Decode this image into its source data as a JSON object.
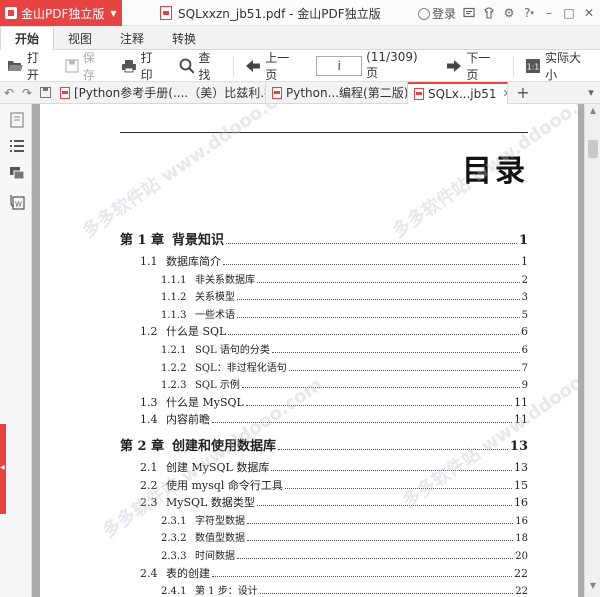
{
  "titlebar": {
    "app_menu_label": "金山PDF独立版",
    "window_title": "SQLxxzn_jb51.pdf - 金山PDF独立版",
    "login_label": "登录",
    "icons": [
      "message-icon",
      "skin-icon",
      "settings-icon",
      "help-icon",
      "minimize-icon",
      "maximize-icon",
      "close-icon"
    ]
  },
  "ribbon": {
    "tabs": [
      {
        "label": "开始",
        "active": true
      },
      {
        "label": "视图",
        "active": false
      },
      {
        "label": "注释",
        "active": false
      },
      {
        "label": "转换",
        "active": false
      }
    ]
  },
  "toolbar": {
    "open_label": "打开",
    "save_label": "保存",
    "print_label": "打印",
    "find_label": "查找",
    "prev_label": "上一页",
    "page_value": "i",
    "page_count": "(11/309)",
    "page_unit": "页",
    "next_label": "下一页",
    "actual_size_label": "实际大小"
  },
  "doc_tabs": [
    {
      "label": "[Python参考手册(....（美）比兹利.扫描版",
      "active": false
    },
    {
      "label": "Python...编程(第二版)",
      "active": false
    },
    {
      "label": "SQLx...jb51",
      "active": true
    }
  ],
  "watermark_text": "多多软件站 www.ddooo.com",
  "document": {
    "toc_title": "目录",
    "entries": [
      {
        "num": "第 1 章",
        "title": "背景知识",
        "page": "1",
        "level": 1
      },
      {
        "num": "1.1",
        "title": "数据库简介",
        "page": "1",
        "level": 2
      },
      {
        "num": "1.1.1",
        "title": "非关系数据库",
        "page": "2",
        "level": 3
      },
      {
        "num": "1.1.2",
        "title": "关系模型",
        "page": "3",
        "level": 3
      },
      {
        "num": "1.1.3",
        "title": "一些术语",
        "page": "5",
        "level": 3
      },
      {
        "num": "1.2",
        "title": "什么是 SQL",
        "page": "6",
        "level": 2
      },
      {
        "num": "1.2.1",
        "title": "SQL 语句的分类",
        "page": "6",
        "level": 3
      },
      {
        "num": "1.2.2",
        "title": "SQL：非过程化语句",
        "page": "7",
        "level": 3
      },
      {
        "num": "1.2.3",
        "title": "SQL 示例",
        "page": "9",
        "level": 3
      },
      {
        "num": "1.3",
        "title": "什么是 MySQL",
        "page": "11",
        "level": 2
      },
      {
        "num": "1.4",
        "title": "内容前瞻",
        "page": "11",
        "level": 2
      },
      {
        "num": "第 2 章",
        "title": "创建和使用数据库",
        "page": "13",
        "level": 1
      },
      {
        "num": "2.1",
        "title": "创建 MySQL 数据库",
        "page": "13",
        "level": 2
      },
      {
        "num": "2.2",
        "title": "使用 mysql 命令行工具",
        "page": "15",
        "level": 2
      },
      {
        "num": "2.3",
        "title": "MySQL 数据类型",
        "page": "16",
        "level": 2
      },
      {
        "num": "2.3.1",
        "title": "字符型数据",
        "page": "16",
        "level": 3
      },
      {
        "num": "2.3.2",
        "title": "数值型数据",
        "page": "18",
        "level": 3
      },
      {
        "num": "2.3.3",
        "title": "时间数据",
        "page": "20",
        "level": 3
      },
      {
        "num": "2.4",
        "title": "表的创建",
        "page": "22",
        "level": 2
      },
      {
        "num": "2.4.1",
        "title": "第 1 步：设计",
        "page": "22",
        "level": 3
      }
    ]
  },
  "colors": {
    "accent": "#e64343",
    "viewer_bg": "#ababab"
  }
}
